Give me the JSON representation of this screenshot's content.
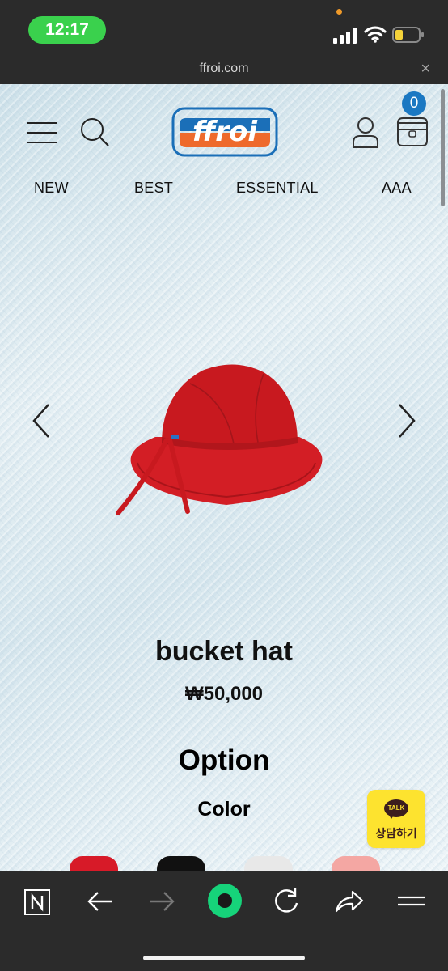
{
  "status_bar": {
    "time": "12:17",
    "time_pill_color": "#3ad14d",
    "icons": [
      "signal-icon",
      "wifi-icon",
      "battery-icon"
    ]
  },
  "address_bar": {
    "url": "ffroi.com",
    "close_label": "×"
  },
  "header": {
    "logo_text": "ffroi",
    "cart_count": "0",
    "icons": [
      "menu-icon",
      "search-icon",
      "user-icon",
      "cart-icon"
    ],
    "nav": [
      "NEW",
      "BEST",
      "ESSENTIAL",
      "AAA"
    ]
  },
  "product": {
    "name": "bucket hat",
    "price": "₩50,000",
    "image": "red-bucket-hat",
    "colors": [
      "#d71a28",
      "#111111",
      "#e8e8e8",
      "#f4a7a3"
    ]
  },
  "options": {
    "title": "Option",
    "color_label": "Color"
  },
  "chat": {
    "bubble_text": "TALK",
    "label": "상담하기",
    "color": "#fde32f"
  },
  "toolbar": {
    "buttons": [
      "naver-icon",
      "back-icon",
      "forward-icon",
      "green-dot-icon",
      "reload-icon",
      "share-icon",
      "menu-lines-icon"
    ],
    "accent": "#16d37a"
  }
}
